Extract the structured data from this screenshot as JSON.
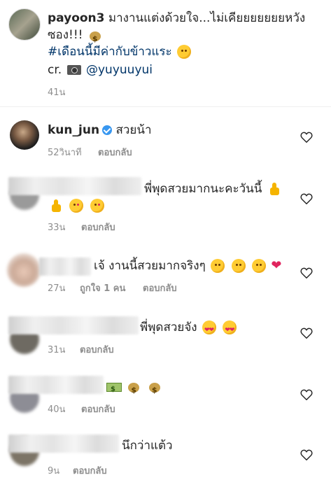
{
  "caption": {
    "username": "payoon3",
    "text_line1": "มางานแต่งด้วยใจ...ไม่เคียยยยยยยหวัง",
    "text_line2": "ซอง!!!",
    "hashtag": "#เดือนนี้มีค่ากับข้าวแระ",
    "credit_prefix": "cr.",
    "credit_handle": "@yuyuuyui",
    "time": "41น"
  },
  "comments": [
    {
      "username": "kun_jun",
      "verified": true,
      "text": "สวยน้า",
      "time": "52วินาที",
      "reply": "ตอบกลับ"
    },
    {
      "text": "พี่พุดสวยมากนะคะวันนี้",
      "time": "33น",
      "reply": "ตอบกลับ"
    },
    {
      "text": "เจ้ งานนี้สวยมากจริงๆ",
      "time": "27น",
      "likes": "ถูกใจ 1 คน",
      "reply": "ตอบกลับ"
    },
    {
      "text": "พี่พุดสวยจัง",
      "time": "31น",
      "reply": "ตอบกลับ"
    },
    {
      "text": "",
      "time": "40น",
      "reply": "ตอบกลับ"
    },
    {
      "text": "นึกว่าแต้ว",
      "time": "9น",
      "reply": "ตอบกลับ"
    }
  ],
  "icons": {
    "like": "heart-outline-icon",
    "verified": "verified-badge-icon"
  },
  "colors": {
    "meta": "#8e8e8e",
    "verified": "#3897f0",
    "heart": "#e0245e"
  }
}
